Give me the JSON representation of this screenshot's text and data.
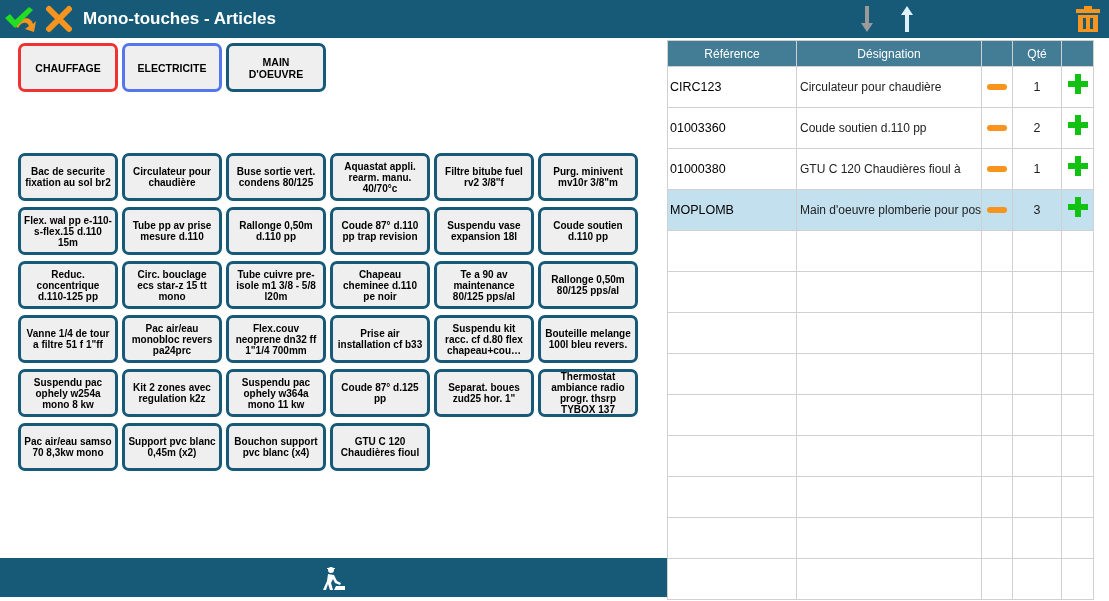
{
  "window": {
    "title": "Mono-touches - Articles"
  },
  "categories": [
    {
      "label": "CHAUFFAGE",
      "color": "#ee3333"
    },
    {
      "label": "ELECTRICITE",
      "color": "#5577ee"
    },
    {
      "label": "MAIN D'OEUVRE",
      "color": "#165a78"
    }
  ],
  "articles": [
    "Bac de securite fixation au sol br2",
    "Circulateur pour chaudière",
    "Buse sortie vert. condens 80/125",
    "Aquastat appli. rearm. manu. 40/70°c",
    "Filtre bitube fuel rv2 3/8\"f",
    "Purg. minivent mv10r 3/8\"m",
    "Flex. wal pp e-110-s-flex.15 d.110 15m",
    "Tube pp av prise mesure d.110",
    "Rallonge 0,50m d.110 pp",
    "Coude 87° d.110 pp trap revision",
    "Suspendu vase expansion 18l",
    "Coude soutien d.110 pp",
    "Reduc. concentrique d.110-125 pp",
    "Circ. bouclage ecs star-z 15 tt mono",
    "Tube cuivre pre-isole m1 3/8 - 5/8 l20m",
    "Chapeau cheminee d.110 pe noir",
    "Te a 90 av maintenance 80/125 pps/al",
    "Rallonge 0,50m 80/125 pps/al",
    "Vanne 1/4 de tour a filtre 51 f 1\"ff",
    "Pac air/eau monobloc revers pa24prc",
    "Flex.couv neoprene dn32 ff 1\"1/4 700mm",
    "Prise air installation cf b33",
    "Suspendu kit racc. cf d.80 flex chapeau+cou…",
    "Bouteille melange 100l bleu revers.",
    "Suspendu pac ophely w254a mono 8 kw",
    "Kit 2 zones avec regulation k2z",
    "Suspendu pac ophely w364a mono 11 kw",
    "Coude 87° d.125 pp",
    "Separat. boues zud25 hor. 1\"",
    "Thermostat ambiance radio progr. thsrp TYBOX 137",
    "Pac air/eau samso 70 8,3kw mono",
    "Support pvc blanc 0,45m (x2)",
    "Bouchon support pvc blanc (x4)",
    "GTU C 120 Chaudières fioul"
  ],
  "table": {
    "columns": [
      "Référence",
      "Désignation",
      "",
      "Qté",
      ""
    ],
    "rows": [
      {
        "reference": "CIRC123",
        "designation": "Circulateur pour chaudière",
        "qty": "1",
        "selected": false
      },
      {
        "reference": "01003360",
        "designation": "Coude soutien d.110 pp",
        "qty": "2",
        "selected": false
      },
      {
        "reference": "01000380",
        "designation": "GTU C 120 Chaudières fioul à",
        "qty": "1",
        "selected": false
      },
      {
        "reference": "MOPLOMB",
        "designation": "Main d'oeuvre plomberie pour pos",
        "qty": "3",
        "selected": true
      }
    ]
  }
}
